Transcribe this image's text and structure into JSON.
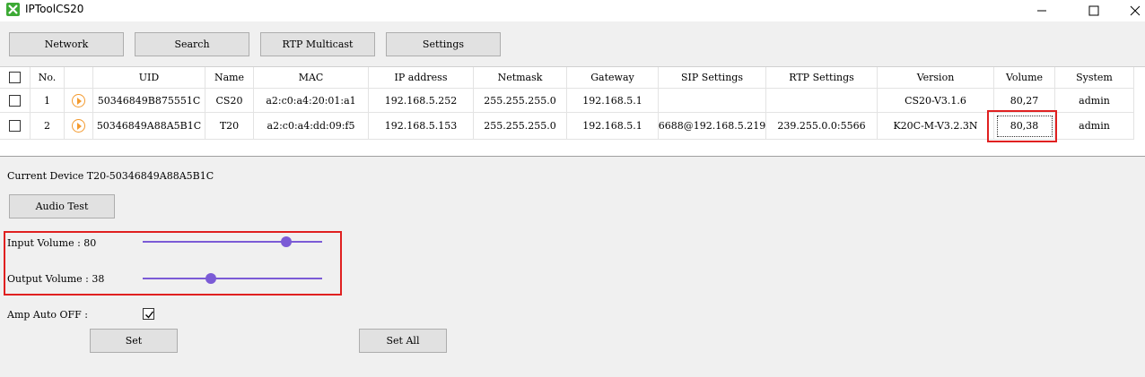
{
  "window": {
    "title": "IPToolCS20",
    "icon": "app-tool-icon",
    "controls": [
      "minimize-icon",
      "maximize-icon",
      "close-icon"
    ]
  },
  "toolbar": {
    "network_label": "Network",
    "search_label": "Search",
    "rtp_label": "RTP Multicast",
    "settings_label": "Settings"
  },
  "table": {
    "columns": [
      "No.",
      "UID",
      "Name",
      "MAC",
      "IP address",
      "Netmask",
      "Gateway",
      "SIP Settings",
      "RTP Settings",
      "Version",
      "Volume",
      "System"
    ],
    "rows": [
      {
        "no": "1",
        "uid": "50346849B875551C",
        "name": "CS20",
        "mac": "a2:c0:a4:20:01:a1",
        "ip": "192.168.5.252",
        "netmask": "255.255.255.0",
        "gateway": "192.168.5.1",
        "sip": "",
        "rtp": "",
        "version": "CS20-V3.1.6",
        "volume": "80,27",
        "system": "admin"
      },
      {
        "no": "2",
        "uid": "50346849A88A5B1C",
        "name": "T20",
        "mac": "a2:c0:a4:dd:09:f5",
        "ip": "192.168.5.153",
        "netmask": "255.255.255.0",
        "gateway": "192.168.5.1",
        "sip": "6688@192.168.5.219",
        "rtp": "239.255.0.0:5566",
        "version": "K20C-M-V3.2.3N",
        "volume": "80,38",
        "system": "admin"
      }
    ]
  },
  "panel": {
    "current_device": "Current Device T20-50346849A88A5B1C",
    "audio_test_label": "Audio Test",
    "input_volume_label": "Input Volume : 80",
    "input_volume": 80,
    "output_volume_label": "Output Volume : 38",
    "output_volume": 38,
    "amp_auto_off_label": "Amp Auto OFF :",
    "amp_auto_off_checked": true,
    "set_label": "Set",
    "set_all_label": "Set All"
  },
  "colors": {
    "slider": "#7b5bd6",
    "highlight": "#e02020",
    "play_icon": "#f39a2e",
    "app_icon": "#3daa35"
  }
}
